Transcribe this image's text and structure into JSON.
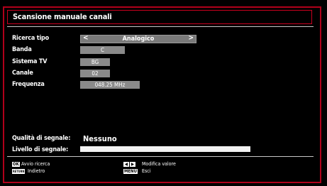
{
  "title": "Scansione manuale canali",
  "fields": {
    "search_type": {
      "label": "Ricerca tipo",
      "value": "Analogico",
      "left_arrow": "<",
      "right_arrow": ">"
    },
    "band": {
      "label": "Banda",
      "value": "C"
    },
    "tv_system": {
      "label": "Sistema TV",
      "value": "BG"
    },
    "channel": {
      "label": "Canale",
      "value": "02"
    },
    "frequency": {
      "label": "Frequenza",
      "value": "048.25 MHz"
    }
  },
  "signal": {
    "quality_label": "Qualità di segnale:",
    "quality_value": "Nessuno",
    "level_label": "Livello di segnale:",
    "level_fraction": 1.0
  },
  "footer": {
    "ok_key": "OK",
    "ok_hint": "Avvio ricerca",
    "return_key": "RETURN",
    "return_hint": "Indietro",
    "arrows_hint": "Modifica valore",
    "menu_key": "MENU",
    "menu_hint": "Esci"
  },
  "colors": {
    "frame_border": "#b0001a",
    "background": "#000000",
    "value_box": "#8a8a8a"
  }
}
